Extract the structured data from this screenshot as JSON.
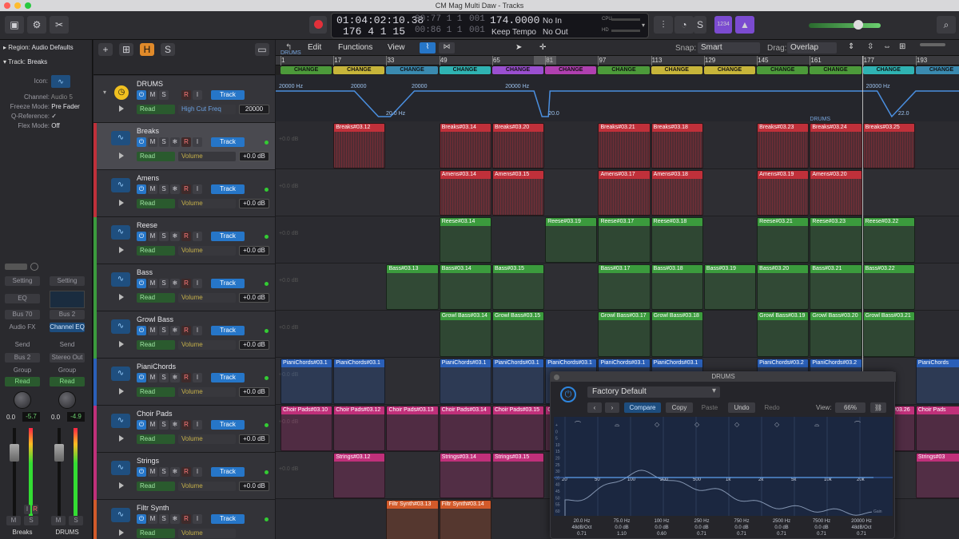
{
  "window": {
    "title": "CM Mag Multi Daw - Tracks"
  },
  "transport": {
    "smpte": "01:04:02:10.38",
    "bars": "176  4  1     15",
    "pos_dim1": "00:77  1  1",
    "pos_dim2": "00:86  1  1",
    "pos_dim1_tail": "001",
    "pos_dim2_tail": "001",
    "tempo": "174.0000",
    "tempo_label": "Keep Tempo",
    "no_in": "No In",
    "no_out": "No Out",
    "cpu_label": "CPU",
    "hd_label": "HD",
    "display_label": "1234"
  },
  "inspector": {
    "region_label": "Region:",
    "region_value": "Audio Defaults",
    "track_label": "Track:",
    "track_value": "Breaks",
    "rows": [
      {
        "label": "Icon:",
        "value": ""
      },
      {
        "label": "Channel:",
        "value": "Audio 5"
      },
      {
        "label": "Freeze Mode:",
        "value": "Pre Fader"
      },
      {
        "label": "Q-Reference:",
        "value": "✓"
      },
      {
        "label": "Flex Mode:",
        "value": "Off"
      }
    ],
    "strips": [
      {
        "setting": "Setting",
        "eq": "EQ",
        "bus": "Bus 70",
        "fx": "Audio FX",
        "send": "Send",
        "io": "Bus 2",
        "group": "Group",
        "auto": "Read",
        "vol": "0.0",
        "peak": "-5.7",
        "name": "Breaks"
      },
      {
        "setting": "Setting",
        "eq": "",
        "bus": "Bus 2",
        "fx": "Channel EQ",
        "send": "Send",
        "io": "Stereo Out",
        "group": "Group",
        "auto": "Read",
        "vol": "0.0",
        "peak": "-4.9",
        "name": "DRUMS"
      }
    ],
    "strip_btn_m": "M",
    "strip_btn_s": "S",
    "strip_btn_i": "I",
    "strip_btn_r": "R"
  },
  "tracklist": {
    "header_h": "H",
    "header_s": "S",
    "folder": {
      "name": "DRUMS",
      "param": "High Cut Freq",
      "value": "20000",
      "auto": "Read",
      "track_btn": "Track"
    },
    "tracks": [
      {
        "name": "Breaks",
        "color": "#c0303a",
        "auto": "Read",
        "param": "Volume",
        "value": "+0.0 dB",
        "track_btn": "Track",
        "sel": true
      },
      {
        "name": "Amens",
        "color": "#c0303a",
        "auto": "Read",
        "param": "Volume",
        "value": "+0.0 dB",
        "track_btn": "Track"
      },
      {
        "name": "Reese",
        "color": "#3b9b3d",
        "auto": "Read",
        "param": "Volume",
        "value": "+0.0 dB",
        "track_btn": "Track"
      },
      {
        "name": "Bass",
        "color": "#3b9b3d",
        "auto": "Read",
        "param": "Volume",
        "value": "+0.0 dB",
        "track_btn": "Track"
      },
      {
        "name": "Growl Bass",
        "color": "#3b9b3d",
        "auto": "Read",
        "param": "Volume",
        "value": "+0.0 dB",
        "track_btn": "Track"
      },
      {
        "name": "PianiChords",
        "color": "#2a5fb8",
        "auto": "Read",
        "param": "Volume",
        "value": "+0.0 dB",
        "track_btn": "Track"
      },
      {
        "name": "Choir Pads",
        "color": "#c0307a",
        "auto": "Read",
        "param": "Volume",
        "value": "+0.0 dB",
        "track_btn": "Track"
      },
      {
        "name": "Strings",
        "color": "#c0307a",
        "auto": "Read",
        "param": "Volume",
        "value": "+0.0 dB",
        "track_btn": "Track"
      },
      {
        "name": "Filtr Synth",
        "color": "#d25a2a",
        "auto": "Read",
        "param": "Volume",
        "value": "",
        "track_btn": "Track"
      }
    ],
    "btn_m": "M",
    "btn_s": "S",
    "btn_r": "R",
    "btn_i": "I",
    "btn_freeze": "❄"
  },
  "arrange_menu": {
    "edit": "Edit",
    "functions": "Functions",
    "view": "View",
    "snap_label": "Snap:",
    "snap_value": "Smart",
    "drag_label": "Drag:",
    "drag_value": "Overlap"
  },
  "ruler": {
    "bars": [
      "1",
      "17",
      "33",
      "49",
      "65",
      "81",
      "97",
      "113",
      "129",
      "145",
      "161",
      "177",
      "193"
    ]
  },
  "markers": {
    "label": "CHANGE",
    "colors": [
      "#4c9a3a",
      "#c7b53a",
      "#3a8ab0",
      "#2fb3b3",
      "#9a4fd0",
      "#b040b0",
      "#4c9a3a",
      "#c7b53a",
      "#c7b53a",
      "#4c9a3a",
      "#4c9a3a",
      "#2fb3b3",
      "#3a8ab0"
    ],
    "folder_label": "DRUMS",
    "folder_label2": "DRUMS"
  },
  "automation": {
    "labels": [
      "20000 Hz",
      "20000",
      "20000",
      "20.0 Hz",
      "20000 Hz",
      "20.0",
      "20000 Hz",
      "22.0"
    ]
  },
  "regions": [
    [
      {
        "bar": 17,
        "len": 16,
        "label": "Breaks#03.12"
      },
      {
        "bar": 49,
        "len": 16,
        "label": "Breaks#03.14"
      },
      {
        "bar": 65,
        "len": 16,
        "label": "Breaks#03.20"
      },
      {
        "bar": 97,
        "len": 16,
        "label": "Breaks#03.21"
      },
      {
        "bar": 113,
        "len": 16,
        "label": "Breaks#03.18"
      },
      {
        "bar": 145,
        "len": 16,
        "label": "Breaks#03.23"
      },
      {
        "bar": 161,
        "len": 16,
        "label": "Breaks#03.24"
      },
      {
        "bar": 177,
        "len": 16,
        "label": "Breaks#03.25"
      }
    ],
    [
      {
        "bar": 49,
        "len": 16,
        "label": "Amens#03.14"
      },
      {
        "bar": 65,
        "len": 16,
        "label": "Amens#03.15"
      },
      {
        "bar": 97,
        "len": 16,
        "label": "Amens#03.17"
      },
      {
        "bar": 113,
        "len": 16,
        "label": "Amens#03.18"
      },
      {
        "bar": 145,
        "len": 16,
        "label": "Amens#03.19"
      },
      {
        "bar": 161,
        "len": 16,
        "label": "Amens#03.20"
      }
    ],
    [
      {
        "bar": 49,
        "len": 16,
        "label": "Reese#03.14"
      },
      {
        "bar": 81,
        "len": 16,
        "label": "Reese#03.19"
      },
      {
        "bar": 97,
        "len": 16,
        "label": "Reese#03.17"
      },
      {
        "bar": 113,
        "len": 16,
        "label": "Reese#03.18"
      },
      {
        "bar": 145,
        "len": 16,
        "label": "Reese#03.21"
      },
      {
        "bar": 161,
        "len": 16,
        "label": "Reese#03.23"
      },
      {
        "bar": 177,
        "len": 16,
        "label": "Reese#03.22"
      }
    ],
    [
      {
        "bar": 33,
        "len": 16,
        "label": "Bass#03.13"
      },
      {
        "bar": 49,
        "len": 16,
        "label": "Bass#03.14"
      },
      {
        "bar": 65,
        "len": 16,
        "label": "Bass#03.15"
      },
      {
        "bar": 97,
        "len": 16,
        "label": "Bass#03.17"
      },
      {
        "bar": 113,
        "len": 16,
        "label": "Bass#03.18"
      },
      {
        "bar": 129,
        "len": 16,
        "label": "Bass#03.19"
      },
      {
        "bar": 145,
        "len": 16,
        "label": "Bass#03.20"
      },
      {
        "bar": 161,
        "len": 16,
        "label": "Bass#03.21"
      },
      {
        "bar": 177,
        "len": 16,
        "label": "Bass#03.22"
      }
    ],
    [
      {
        "bar": 49,
        "len": 16,
        "label": "Growl Bass#03.14"
      },
      {
        "bar": 65,
        "len": 16,
        "label": "Growl Bass#03.15"
      },
      {
        "bar": 97,
        "len": 16,
        "label": "Growl Bass#03.17"
      },
      {
        "bar": 113,
        "len": 16,
        "label": "Growl Bass#03.18"
      },
      {
        "bar": 145,
        "len": 16,
        "label": "Growl Bass#03.19"
      },
      {
        "bar": 161,
        "len": 16,
        "label": "Growl Bass#03.20"
      },
      {
        "bar": 177,
        "len": 16,
        "label": "Growl Bass#03.21"
      }
    ],
    [
      {
        "bar": 1,
        "len": 16,
        "label": "PianiChords#03.1"
      },
      {
        "bar": 17,
        "len": 16,
        "label": "PianiChords#03.1"
      },
      {
        "bar": 49,
        "len": 16,
        "label": "PianiChords#03.1"
      },
      {
        "bar": 65,
        "len": 16,
        "label": "PianiChords#03.1"
      },
      {
        "bar": 81,
        "len": 16,
        "label": "PianiChords#03.1"
      },
      {
        "bar": 97,
        "len": 16,
        "label": "PianiChords#03.1"
      },
      {
        "bar": 113,
        "len": 16,
        "label": "PianiChords#03.1"
      },
      {
        "bar": 145,
        "len": 16,
        "label": "PianiChords#03.2"
      },
      {
        "bar": 161,
        "len": 16,
        "label": "PianiChords#03.2"
      },
      {
        "bar": 193,
        "len": 16,
        "label": "PianiChords"
      }
    ],
    [
      {
        "bar": 1,
        "len": 16,
        "label": "Choir Pads#03.10"
      },
      {
        "bar": 17,
        "len": 16,
        "label": "Choir Pads#03.12"
      },
      {
        "bar": 33,
        "len": 16,
        "label": "Choir Pads#03.13"
      },
      {
        "bar": 49,
        "len": 16,
        "label": "Choir Pads#03.14"
      },
      {
        "bar": 65,
        "len": 16,
        "label": "Choir Pads#03.15"
      },
      {
        "bar": 81,
        "len": 16,
        "label": "Choir Pads#03.1"
      },
      {
        "bar": 177,
        "len": 16,
        "label": "Choir Pads#03.26"
      },
      {
        "bar": 193,
        "len": 16,
        "label": "Choir Pads"
      }
    ],
    [
      {
        "bar": 17,
        "len": 16,
        "label": "Strings#03.12"
      },
      {
        "bar": 49,
        "len": 16,
        "label": "Strings#03.14"
      },
      {
        "bar": 65,
        "len": 16,
        "label": "Strings#03.15"
      },
      {
        "bar": 193,
        "len": 16,
        "label": "Strings#03"
      }
    ],
    [
      {
        "bar": 33,
        "len": 16,
        "label": "Filtr Synth#03.13"
      },
      {
        "bar": 49,
        "len": 16,
        "label": "Filtr Synth#03.14"
      }
    ]
  ],
  "plugin": {
    "title": "DRUMS",
    "preset": "Factory Default",
    "compare": "Compare",
    "copy": "Copy",
    "paste": "Paste",
    "undo": "Undo",
    "redo": "Redo",
    "view_label": "View:",
    "view_value": "66%",
    "freq_scale": [
      "20",
      "50",
      "100",
      "200",
      "500",
      "1k",
      "2k",
      "5k",
      "10k",
      "20k"
    ],
    "bands": [
      {
        "freq": "20.0 Hz",
        "gain": "48dB/Oct",
        "q": "0.71"
      },
      {
        "freq": "75.0 Hz",
        "gain": "0.0 dB",
        "q": "1.10"
      },
      {
        "freq": "100 Hz",
        "gain": "0.0 dB",
        "q": "0.60"
      },
      {
        "freq": "250 Hz",
        "gain": "0.0 dB",
        "q": "0.71"
      },
      {
        "freq": "750 Hz",
        "gain": "0.0 dB",
        "q": "0.71"
      },
      {
        "freq": "2500 Hz",
        "gain": "0.0 dB",
        "q": "0.71"
      },
      {
        "freq": "7500 Hz",
        "gain": "0.0 dB",
        "q": "0.71"
      },
      {
        "freq": "20000 Hz",
        "gain": "48dB/Oct",
        "q": "0.71"
      }
    ],
    "db_scale": [
      "+",
      "0",
      "5",
      "10",
      "15",
      "20",
      "25",
      "30",
      "35",
      "40",
      "45",
      "50",
      "55",
      "60"
    ],
    "gain_label": "Gain"
  }
}
